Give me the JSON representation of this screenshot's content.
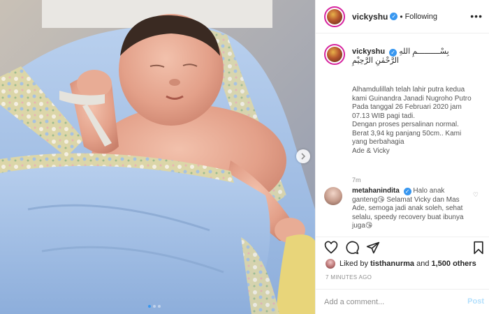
{
  "header": {
    "username": "vickyshu",
    "separator": "•",
    "follow_status": "Following",
    "more_icon": "more-options-icon"
  },
  "caption": {
    "username": "vickyshu",
    "bismillah": "بِسْــــــــــمِ اللهِ الرَّحْمٰنِ الرَّحِيْمِ",
    "lines": [
      "Alhamdulillah telah lahir putra kedua kami Guinandra Janadi Nugroho Putro",
      "Pada tanggal 26 Februari 2020 jam 07.13 WIB pagi tadi.",
      "Dengan proses persalinan normal.",
      "Berat 3,94 kg panjang 50cm.. Kami yang berbahagia",
      "Ade & Vicky"
    ],
    "time": "7m"
  },
  "comment": {
    "username": "metahanindita",
    "text": "Halo anak ganteng😘 Selamat Vicky dan Mas Ade, semoga jadi anak soleh, sehat selalu, speedy recovery buat ibunya juga😘"
  },
  "likes": {
    "prefix": "Liked by",
    "user": "tisthanurma",
    "and": "and",
    "others": "1,500 others"
  },
  "posted": "7 MINUTES AGO",
  "add_comment": {
    "placeholder": "Add a comment...",
    "post_label": "Post"
  },
  "colors": {
    "accent": "#3897f0",
    "muted": "#8e8e8e",
    "post_disabled": "#b2dffc",
    "blanket": "#a9c4e6"
  }
}
